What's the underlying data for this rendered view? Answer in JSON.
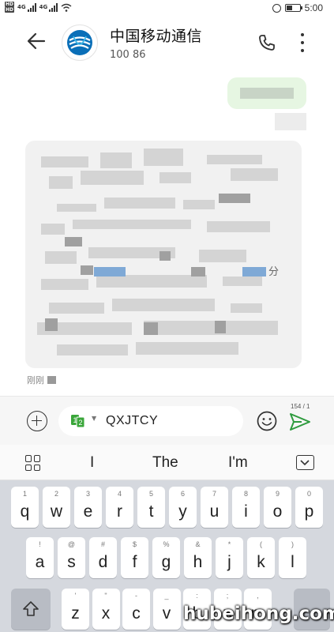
{
  "status_bar": {
    "left_indicators": [
      "HD",
      "4G",
      "4G",
      "wifi"
    ],
    "time": "5:00"
  },
  "header": {
    "back_icon": "arrow-left-icon",
    "avatar_icon": "china-mobile-logo",
    "title": "中国移动通信",
    "number": "100 86",
    "call_icon": "phone-icon",
    "more_icon": "more-vertical-icon"
  },
  "chat": {
    "outgoing_message": "",
    "incoming_message_fragment": "分",
    "incoming_time": "刚刚"
  },
  "composer": {
    "sim_slot": "2",
    "input_value": "QXJTCY",
    "char_counter": "154 / 1",
    "add_icon": "plus-circle-icon",
    "emoji_icon": "smiley-icon",
    "send_icon": "send-icon"
  },
  "suggestions": {
    "items": [
      "I",
      "The",
      "I'm"
    ],
    "grid_icon": "apps-grid-icon",
    "hide_icon": "keyboard-hide-icon"
  },
  "keyboard": {
    "row1": [
      {
        "k": "q",
        "h": "1"
      },
      {
        "k": "w",
        "h": "2"
      },
      {
        "k": "e",
        "h": "3"
      },
      {
        "k": "r",
        "h": "4"
      },
      {
        "k": "t",
        "h": "5"
      },
      {
        "k": "y",
        "h": "6"
      },
      {
        "k": "u",
        "h": "7"
      },
      {
        "k": "i",
        "h": "8"
      },
      {
        "k": "o",
        "h": "9"
      },
      {
        "k": "p",
        "h": "0"
      }
    ],
    "row2": [
      {
        "k": "a",
        "h": "!"
      },
      {
        "k": "s",
        "h": "@"
      },
      {
        "k": "d",
        "h": "#"
      },
      {
        "k": "f",
        "h": "$"
      },
      {
        "k": "g",
        "h": "%"
      },
      {
        "k": "h",
        "h": "&"
      },
      {
        "k": "j",
        "h": "*"
      },
      {
        "k": "k",
        "h": "("
      },
      {
        "k": "l",
        "h": ")"
      }
    ],
    "row3": [
      {
        "k": "z",
        "h": "'"
      },
      {
        "k": "x",
        "h": "\""
      },
      {
        "k": "c",
        "h": "-"
      },
      {
        "k": "v",
        "h": "_"
      },
      {
        "k": "b",
        "h": ":"
      },
      {
        "k": "n",
        "h": ";"
      },
      {
        "k": "m",
        "h": ","
      }
    ],
    "shift_icon": "shift-arrow-icon"
  },
  "watermark": "hubeihong.com"
}
